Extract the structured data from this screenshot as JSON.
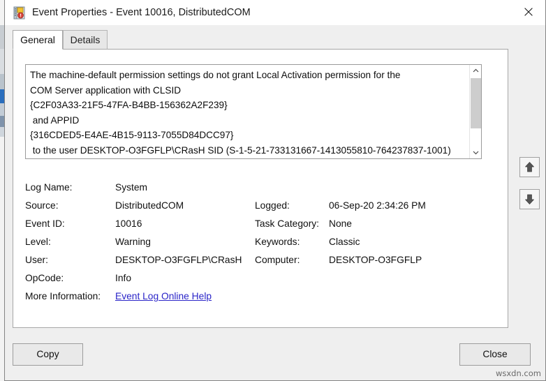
{
  "window": {
    "title": "Event Properties - Event 10016, DistributedCOM",
    "icon": "event-log-warning-icon",
    "close_glyph": "✕"
  },
  "tabs": [
    {
      "label": "General",
      "selected": true
    },
    {
      "label": "Details",
      "selected": false
    }
  ],
  "description": {
    "text": "The machine-default permission settings do not grant Local Activation permission for the\nCOM Server application with CLSID\n{C2F03A33-21F5-47FA-B4BB-156362A2F239}\n and APPID\n{316CDED5-E4AE-4B15-9113-7055D84DCC97}\n to the user DESKTOP-O3FGFLP\\CRasH SID (S-1-5-21-733131667-1413055810-764237837-1001)\nfrom address LocalHost (Using LRPC) running in the application container",
    "scrollbar": {
      "up_arrow": "chevron-up",
      "down_arrow": "chevron-down"
    }
  },
  "properties": {
    "left": [
      {
        "label": "Log Name:",
        "value": "System"
      },
      {
        "label": "Source:",
        "value": "DistributedCOM"
      },
      {
        "label": "Event ID:",
        "value": "10016"
      },
      {
        "label": "Level:",
        "value": "Warning"
      },
      {
        "label": "User:",
        "value": "DESKTOP-O3FGFLP\\CRasH"
      },
      {
        "label": "OpCode:",
        "value": "Info"
      },
      {
        "label": "More Information:",
        "value": "Event Log Online Help"
      }
    ],
    "right": [
      {
        "label": "Logged:",
        "value": "06-Sep-20 2:34:26 PM"
      },
      {
        "label": "Task Category:",
        "value": "None"
      },
      {
        "label": "Keywords:",
        "value": "Classic"
      },
      {
        "label": "Computer:",
        "value": "DESKTOP-O3FGFLP"
      }
    ]
  },
  "navigation": {
    "previous_label": "up-arrow",
    "next_label": "down-arrow"
  },
  "buttons": {
    "copy": "Copy",
    "close": "Close"
  },
  "watermark": "wsxdn.com",
  "colors": {
    "link": "#2a24c8",
    "window_bg": "#efefef",
    "panel_bg": "#ffffff",
    "titlebar_bg": "#ffffff"
  }
}
